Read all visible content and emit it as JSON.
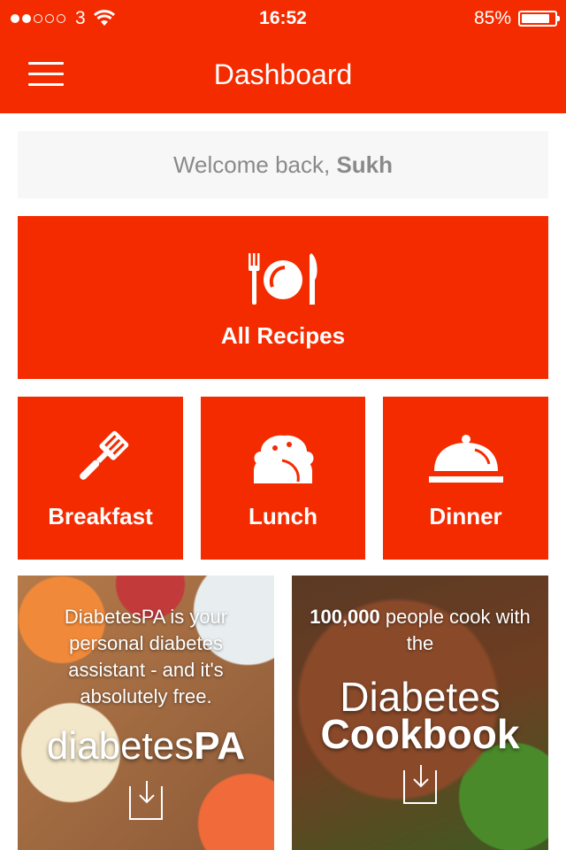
{
  "status_bar": {
    "carrier": "3",
    "time": "16:52",
    "battery": "85%",
    "battery_level": 0.85
  },
  "header": {
    "title": "Dashboard"
  },
  "welcome": {
    "prefix": "Welcome back, ",
    "name": "Sukh"
  },
  "tiles": {
    "all_recipes": "All Recipes",
    "breakfast": "Breakfast",
    "lunch": "Lunch",
    "dinner": "Dinner"
  },
  "promos": {
    "diabetespa": {
      "text": "DiabetesPA is your personal diabetes assistant - and it's absolutely free.",
      "brand_light": "diabetes",
      "brand_bold": "PA"
    },
    "cookbook": {
      "count": "100,000",
      "text": " people cook with the",
      "title_line1": "Diabetes",
      "title_line2": "Cookbook"
    }
  },
  "colors": {
    "accent": "#f52b00",
    "welcome_bg": "#f7f7f7",
    "welcome_text": "#8a8a8a"
  },
  "icons": [
    "menu-icon",
    "wifi-icon",
    "battery-icon",
    "plate-cutlery-icon",
    "spatula-icon",
    "taco-icon",
    "cloche-icon",
    "download-icon"
  ]
}
